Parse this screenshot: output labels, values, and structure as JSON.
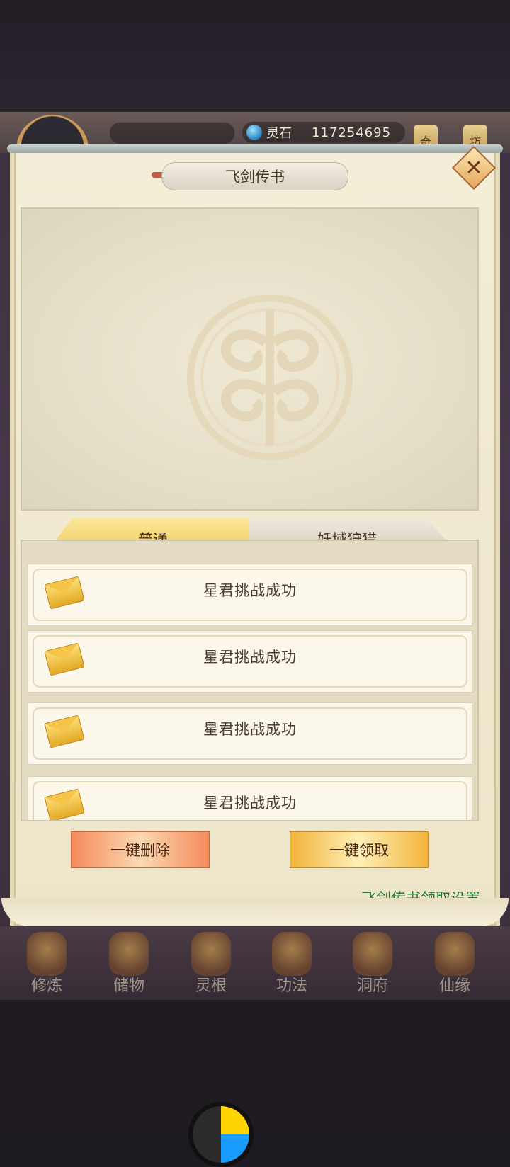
{
  "header": {
    "resource_label": "灵石",
    "resource_value": "117254695",
    "side_tags": [
      "奇",
      "坊"
    ]
  },
  "modal": {
    "title": "飞剑传书",
    "tabs": [
      {
        "label": "普通",
        "active": true
      },
      {
        "label": "妖域狩猎",
        "active": false
      }
    ],
    "mails": [
      {
        "title": "星君挑战成功"
      },
      {
        "title": "星君挑战成功"
      },
      {
        "title": "星君挑战成功"
      },
      {
        "title": "星君挑战成功"
      }
    ],
    "buttons": {
      "delete_all": "一键删除",
      "claim_all": "一键领取"
    },
    "settings_link": "飞剑传书领取设置"
  },
  "bottom_nav": [
    {
      "label": "修炼"
    },
    {
      "label": "储物"
    },
    {
      "label": "灵根"
    },
    {
      "label": "功法"
    },
    {
      "label": "洞府"
    },
    {
      "label": "仙缘"
    }
  ]
}
